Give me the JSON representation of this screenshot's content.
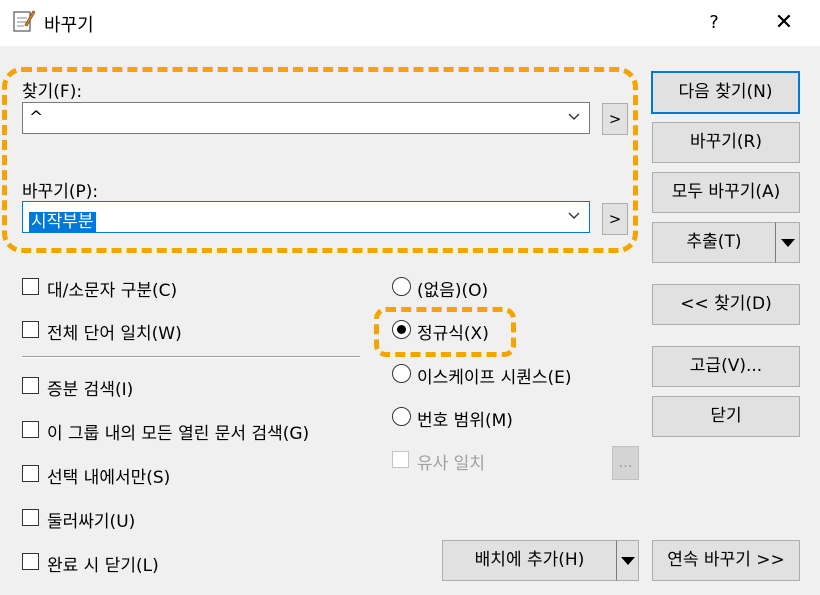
{
  "window": {
    "title": "바꾸기",
    "help": "?",
    "close": "✕"
  },
  "find": {
    "label": "찾기(F):",
    "value": "^",
    "browse": ">"
  },
  "replace": {
    "label": "바꾸기(P):",
    "value": "시작부분",
    "browse": ">"
  },
  "options": {
    "match_case": "대/소문자 구분(C)",
    "whole_word": "전체 단어 일치(W)",
    "incremental": "증분 검색(I)",
    "all_docs": "이 그룹 내의 모든 열린 문서 검색(G)",
    "selection_only": "선택 내에서만(S)",
    "wrap_around": "둘러싸기(U)",
    "close_when_done": "완료 시 닫기(L)"
  },
  "search_mode": {
    "none": "(없음)(O)",
    "regex": "정규식(X)",
    "escape": "이스케이프 시퀀스(E)",
    "range": "번호 범위(M)",
    "similar": "유사 일치",
    "similar_settings": "...",
    "selected": "regex"
  },
  "buttons": {
    "find_next": "다음 찾기(N)",
    "replace": "바꾸기(R)",
    "replace_all": "모두 바꾸기(A)",
    "extract": "추출(T)",
    "find_prev": "<< 찾기(D)",
    "advanced": "고급(V)...",
    "close": "닫기",
    "add_to_batch": "배치에 추가(H)",
    "continuous_replace": "연속 바꾸기 >>"
  },
  "colors": {
    "accent": "#0078d7",
    "highlight": "#f5a300"
  }
}
